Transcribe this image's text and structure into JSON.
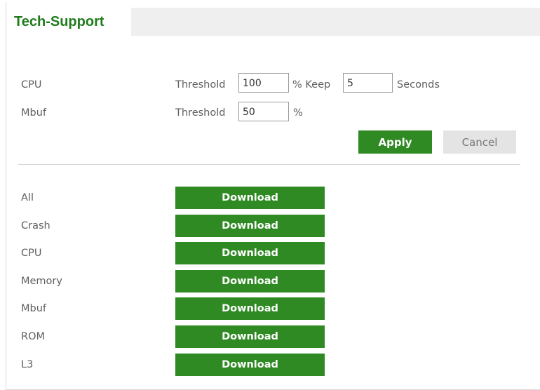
{
  "tab": {
    "title": "Tech-Support"
  },
  "thresholds": {
    "cpu": {
      "label": "CPU",
      "threshold_label": "Threshold",
      "threshold_value": "100",
      "percent_keep_label": "% Keep",
      "keep_value": "5",
      "seconds_label": "Seconds"
    },
    "mbuf": {
      "label": "Mbuf",
      "threshold_label": "Threshold",
      "threshold_value": "50",
      "percent_label": "%"
    }
  },
  "actions": {
    "apply_label": "Apply",
    "cancel_label": "Cancel"
  },
  "downloads": {
    "button_label": "Download",
    "items": [
      {
        "label": "All"
      },
      {
        "label": "Crash"
      },
      {
        "label": "CPU"
      },
      {
        "label": "Memory"
      },
      {
        "label": "Mbuf"
      },
      {
        "label": "ROM"
      },
      {
        "label": "L3"
      }
    ]
  },
  "colors": {
    "accent_green": "#2f8a23",
    "tab_title_green": "#1f7c1c",
    "tab_bar_gray": "#efefef",
    "cancel_gray": "#e4e4e4"
  }
}
